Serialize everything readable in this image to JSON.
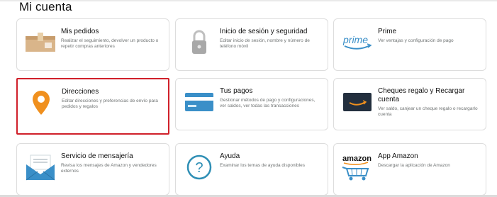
{
  "page": {
    "title": "Mi cuenta"
  },
  "colors": {
    "selected_border": "#d0202a",
    "accent_orange": "#f0901e",
    "blue": "#3a8fc8",
    "dark": "#232f3e"
  },
  "cards": [
    {
      "title": "Mis pedidos",
      "desc": "Realizar el seguimiento, devolver un producto o repetir compras anteriores",
      "icon": "package-icon",
      "selected": false
    },
    {
      "title": "Inicio de sesión y seguridad",
      "desc": "Editar inicio de sesión, nombre y número de teléfono móvil",
      "icon": "lock-icon",
      "selected": false
    },
    {
      "title": "Prime",
      "desc": "Ver ventajas y configuración de pago",
      "icon": "prime-logo",
      "selected": false
    },
    {
      "title": "Direcciones",
      "desc": "Editar direcciones y preferencias de envío para pedidos y regalos",
      "icon": "location-pin-icon",
      "selected": true
    },
    {
      "title": "Tus pagos",
      "desc": "Gestionar métodos de pago y configuraciones, ver saldos, ver todas las transacciones",
      "icon": "credit-card-icon",
      "selected": false
    },
    {
      "title": "Cheques regalo y Recargar cuenta",
      "desc": "Ver saldo, canjear un cheque regalo o recargarlo cuenta",
      "icon": "gift-card-icon",
      "selected": false
    },
    {
      "title": "Servicio de mensajería",
      "desc": "Revisa los mensajes de Amazon y vendedores externos",
      "icon": "message-envelope-icon",
      "selected": false
    },
    {
      "title": "Ayuda",
      "desc": "Examinar los temas de ayuda disponibles",
      "icon": "help-question-icon",
      "selected": false
    },
    {
      "title": "App Amazon",
      "desc": "Descargar la aplicación de Amazon",
      "icon": "amazon-cart-logo",
      "selected": false
    }
  ],
  "logos": {
    "prime_text": "prime",
    "amazon_text": "amazon"
  }
}
